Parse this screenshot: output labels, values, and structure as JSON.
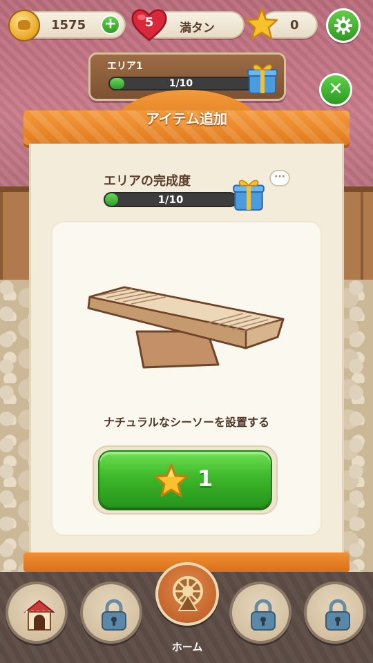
{
  "status_bar": {
    "coins": "1575",
    "hearts": "5",
    "hearts_label": "満タン",
    "stars": "0",
    "coin_icon": "coin-icon",
    "heart_icon": "heart-icon",
    "star_icon": "star-icon",
    "settings_icon": "gear-icon",
    "add_icon": "plus-icon"
  },
  "area_panel": {
    "title": "エリア1",
    "progress_text": "1/10",
    "progress_value": 0.1,
    "icon": "gift-box-icon"
  },
  "modal": {
    "title": "アイテム追加",
    "completion_label": "エリアの完成度",
    "completion_text": "1/10",
    "completion_value": 0.1,
    "hint_icon": "speech-bubble-icon",
    "hint_text": "···",
    "item_name": "ナチュラルなシーソーを設置する",
    "item_icon": "seesaw-icon",
    "cost": "1",
    "cost_icon": "star-icon",
    "close_icon": "close-icon",
    "close_symbol": "✕"
  },
  "bottom_nav": {
    "items": [
      {
        "icon": "hamster-house-icon",
        "locked": false
      },
      {
        "icon": "lock-icon",
        "locked": true
      },
      {
        "icon": "wheel-icon",
        "label": "ホーム",
        "active": true
      },
      {
        "icon": "lock-icon",
        "locked": true
      },
      {
        "icon": "lock-icon",
        "locked": true
      }
    ]
  },
  "colors": {
    "accent_orange": "#e88a2a",
    "button_green": "#3fb82b",
    "progress_green": "#4ec43c",
    "text_brown": "#5a3d2a"
  }
}
